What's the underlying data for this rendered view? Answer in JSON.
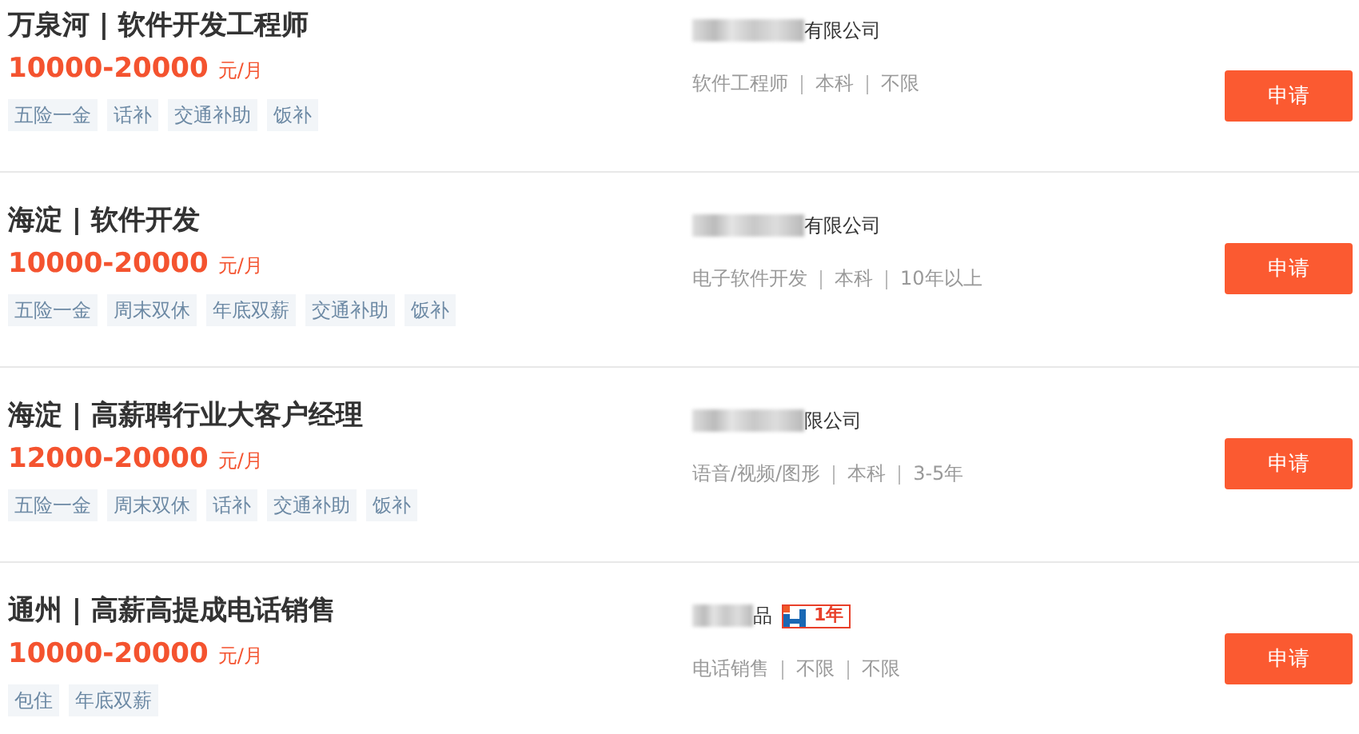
{
  "jobs": [
    {
      "title": "万泉河 | 软件开发工程师",
      "salary": "10000-20000",
      "unit": "元/月",
      "tags": [
        "五险一金",
        "话补",
        "交通补助",
        "饭补"
      ],
      "company": "有限公司",
      "meta": [
        "软件工程师",
        "本科",
        "不限"
      ],
      "apply": "申请"
    },
    {
      "title": "海淀 | 软件开发",
      "salary": "10000-20000",
      "unit": "元/月",
      "tags": [
        "五险一金",
        "周末双休",
        "年底双薪",
        "交通补助",
        "饭补"
      ],
      "company": "有限公司",
      "meta": [
        "电子软件开发",
        "本科",
        "10年以上"
      ],
      "apply": "申请"
    },
    {
      "title": "海淀 | 高薪聘行业大客户经理",
      "salary": "12000-20000",
      "unit": "元/月",
      "tags": [
        "五险一金",
        "周末双休",
        "话补",
        "交通补助",
        "饭补"
      ],
      "company": "限公司",
      "meta": [
        "语音/视频/图形",
        "本科",
        "3-5年"
      ],
      "apply": "申请"
    },
    {
      "title": "通州 | 高薪高提成电话销售",
      "salary": "10000-20000",
      "unit": "元/月",
      "tags": [
        "包住",
        "年底双薪"
      ],
      "company": "品",
      "company_badge": "1年",
      "meta": [
        "电话销售",
        "不限",
        "不限"
      ],
      "apply": "申请"
    }
  ]
}
